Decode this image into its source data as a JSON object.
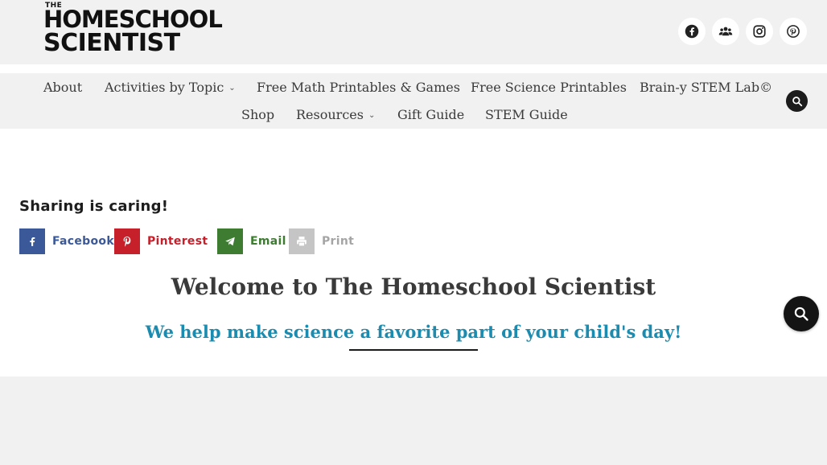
{
  "logo": {
    "top_word": "THE",
    "line1": "HOMESCHOOL",
    "line2": "SCIENTIST"
  },
  "social": [
    {
      "name": "facebook",
      "icon": "facebook-icon"
    },
    {
      "name": "facebook-groups",
      "icon": "group-icon"
    },
    {
      "name": "instagram",
      "icon": "instagram-icon"
    },
    {
      "name": "pinterest",
      "icon": "pinterest-icon"
    }
  ],
  "nav": {
    "row1": [
      "About",
      "Activities by Topic",
      "Free Math Printables & Games",
      "Free Science Printables",
      "Brain-y STEM Lab©"
    ],
    "row2": [
      "Shop",
      "Resources",
      "Gift Guide",
      "STEM Guide"
    ]
  },
  "share": {
    "title": "Sharing is caring!",
    "buttons": [
      {
        "label": "Facebook",
        "icon": "facebook-icon",
        "color": "#3b5998",
        "bg": "#1877f2"
      },
      {
        "label": "Pinterest",
        "icon": "pinterest-icon",
        "color": "#c6202b",
        "bg": "#e60023"
      },
      {
        "label": "Email",
        "icon": "email-icon",
        "color": "#3e7d31",
        "bg": "#359a2b"
      },
      {
        "label": "Print",
        "icon": "print-icon",
        "color": "#a5a5a5",
        "bg": "#a5a5a5"
      }
    ]
  },
  "main": {
    "welcome": "Welcome to The Homeschool Scientist",
    "tagline": "We help make science a favorite part of your child's day!"
  },
  "colors": {
    "accent": "#1b8cb0",
    "header_bg": "#f1f1f1",
    "dark": "#141414"
  }
}
